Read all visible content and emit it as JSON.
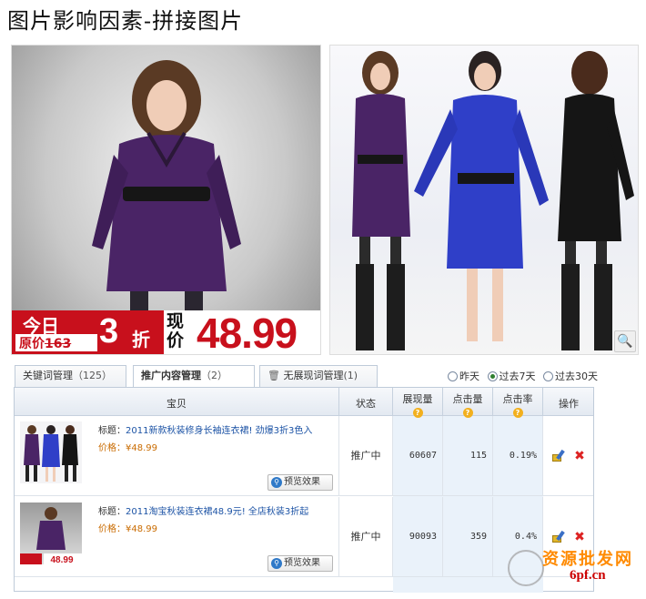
{
  "page_title": "图片影响因素-拼接图片",
  "promo": {
    "today": "今日",
    "orig_label": "原价",
    "orig_price": "163",
    "discount": "3",
    "zhe": "折",
    "now_label": "现价",
    "price": "48.99"
  },
  "tabs": [
    {
      "label": "关键词管理",
      "count": "（125）"
    },
    {
      "label": "推广内容管理",
      "count": "（2）"
    },
    {
      "label": "无展现词管理",
      "count": "(1)"
    }
  ],
  "date_range": {
    "options": [
      "昨天",
      "过去7天",
      "过去30天"
    ],
    "selected": "过去7天"
  },
  "table": {
    "headers": {
      "item": "宝贝",
      "status": "状态",
      "impressions": "展现量",
      "clicks": "点击量",
      "ctr": "点击率",
      "ops": "操作"
    },
    "title_label": "标题：",
    "price_label": "价格：",
    "preview_label": "预览效果",
    "rows": [
      {
        "title": "2011新款秋装修身长袖连衣裙! 劲爆3折3色入",
        "price": "¥48.99",
        "status": "推广中",
        "impressions": "60607",
        "clicks": "115",
        "ctr": "0.19%"
      },
      {
        "title": "2011淘宝秋装连衣裙48.9元! 全店秋装3折起",
        "price": "¥48.99",
        "status": "推广中",
        "impressions": "90093",
        "clicks": "359",
        "ctr": "0.4%"
      }
    ]
  },
  "watermark": {
    "line1": "资源批发网",
    "line2": "6pf.cn"
  },
  "colors": {
    "promo_red": "#c8101c",
    "link_blue": "#1c53a5",
    "metric_bg": "#eaf2fa",
    "help_icon": "#f2b01e"
  }
}
